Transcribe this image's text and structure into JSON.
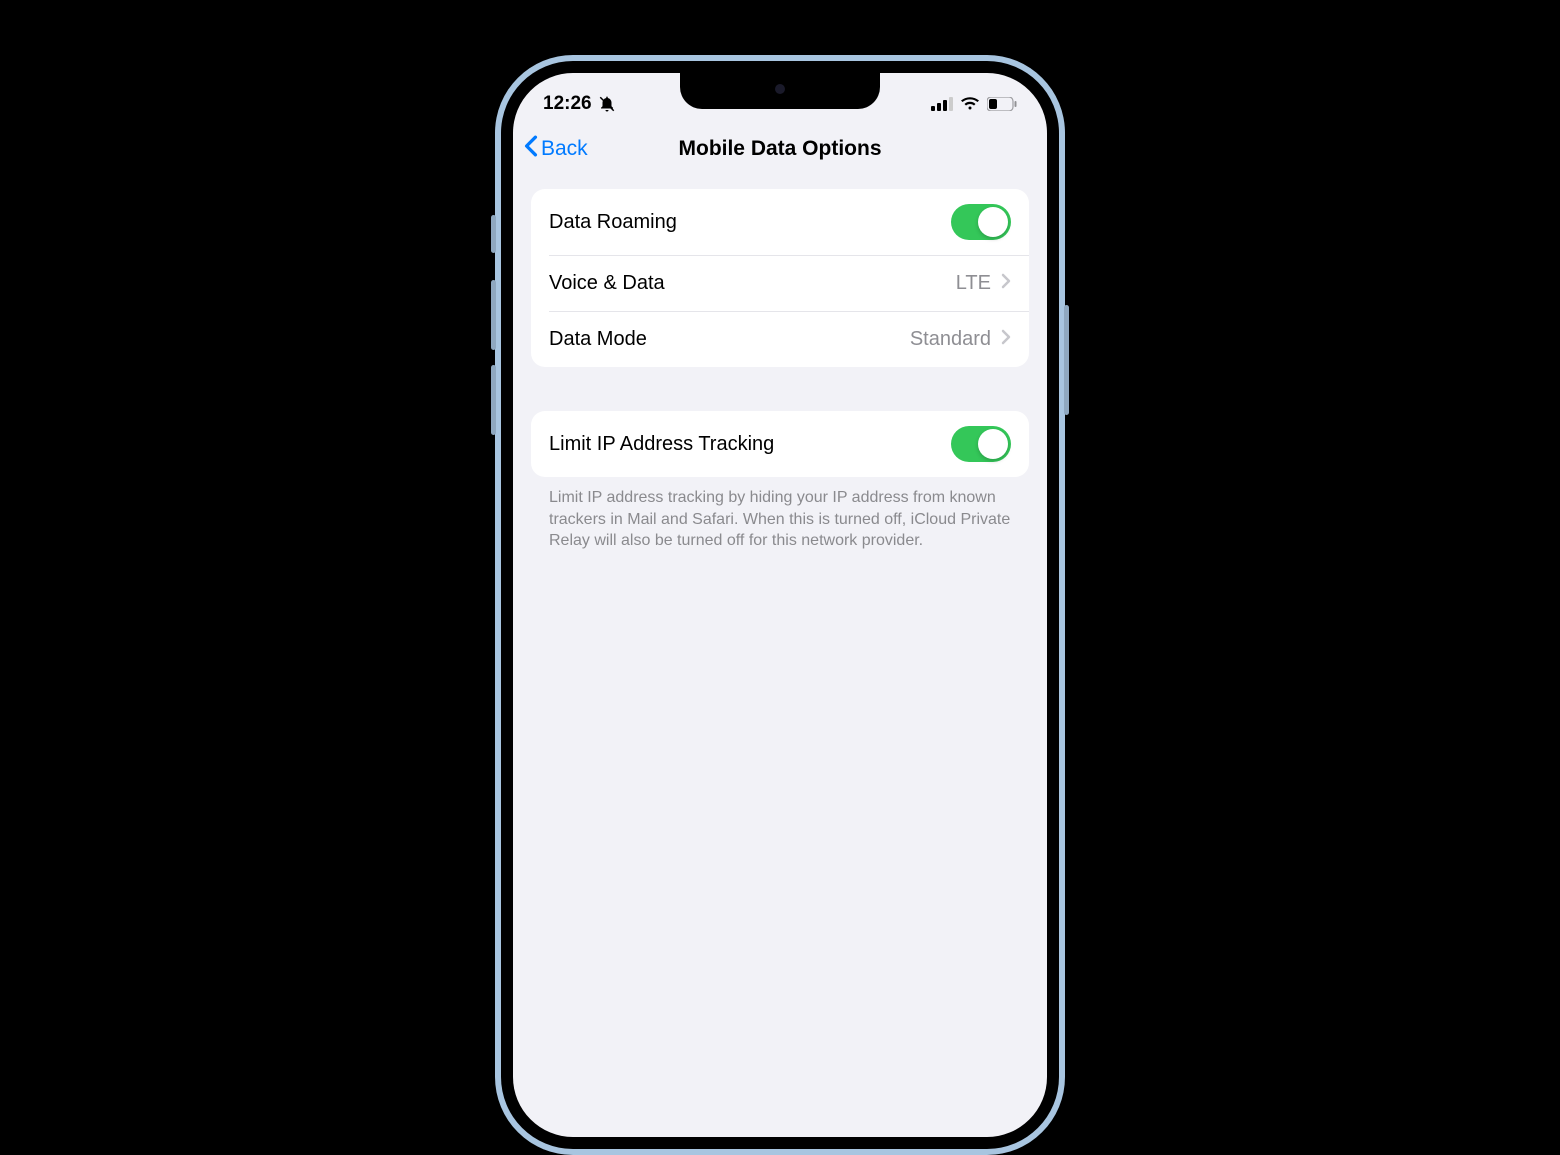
{
  "status": {
    "time": "12:26"
  },
  "nav": {
    "back": "Back",
    "title": "Mobile Data Options"
  },
  "group1": {
    "data_roaming_label": "Data Roaming",
    "data_roaming_on": true,
    "voice_data_label": "Voice & Data",
    "voice_data_value": "LTE",
    "data_mode_label": "Data Mode",
    "data_mode_value": "Standard"
  },
  "group2": {
    "limit_ip_label": "Limit IP Address Tracking",
    "limit_ip_on": true,
    "footer": "Limit IP address tracking by hiding your IP address from known trackers in Mail and Safari. When this is turned off, iCloud Private Relay will also be turned off for this network provider."
  }
}
